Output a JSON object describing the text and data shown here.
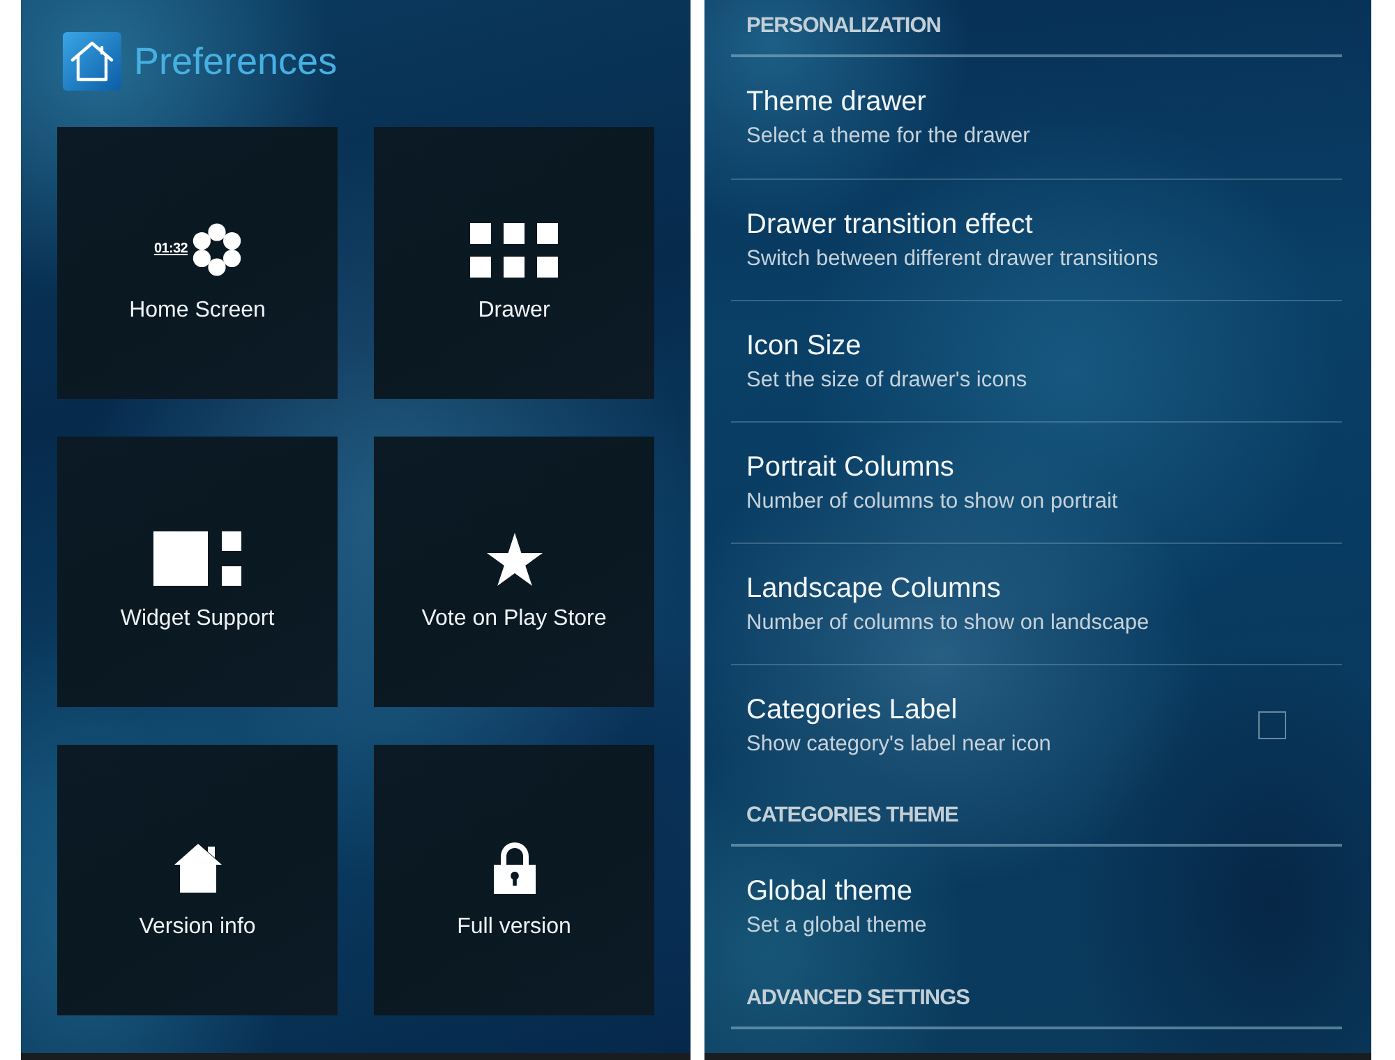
{
  "preferences_screen": {
    "title": "Preferences",
    "tiles": [
      {
        "label": "Home Screen",
        "icon_text": "01:32"
      },
      {
        "label": "Drawer"
      },
      {
        "label": "Widget Support"
      },
      {
        "label": "Vote on Play Store"
      },
      {
        "label": "Version info"
      },
      {
        "label": "Full version"
      }
    ]
  },
  "settings_screen": {
    "sections": [
      {
        "header": "PERSONALIZATION",
        "items": [
          {
            "kind": "text",
            "title": "Theme drawer",
            "subtitle": "Select a theme for the drawer"
          },
          {
            "kind": "text",
            "title": "Drawer transition effect",
            "subtitle": "Switch between different drawer transitions"
          },
          {
            "kind": "text",
            "title": "Icon Size",
            "subtitle": "Set the size of drawer's icons"
          },
          {
            "kind": "text",
            "title": "Portrait Columns",
            "subtitle": "Number of columns to show on portrait"
          },
          {
            "kind": "text",
            "title": "Landscape Columns",
            "subtitle": "Number of columns to show on landscape"
          },
          {
            "kind": "checkbox",
            "title": "Categories Label",
            "subtitle": "Show category's label near icon",
            "checked": false
          }
        ]
      },
      {
        "header": "CATEGORIES THEME",
        "items": [
          {
            "kind": "text",
            "title": "Global theme",
            "subtitle": "Set a global theme"
          }
        ]
      },
      {
        "header": "ADVANCED SETTINGS"
      }
    ]
  }
}
